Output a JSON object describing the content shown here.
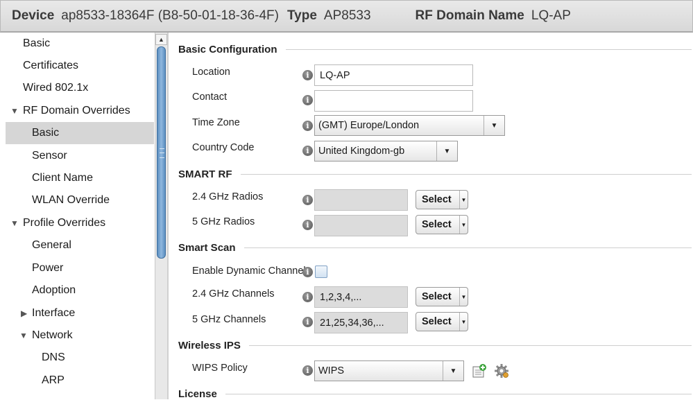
{
  "header": {
    "device_label": "Device",
    "device_value": "ap8533-18364F (B8-50-01-18-36-4F)",
    "type_label": "Type",
    "type_value": "AP8533",
    "rf_label": "RF Domain Name",
    "rf_value": "LQ-AP"
  },
  "sidebar": {
    "items": [
      {
        "label": "Basic"
      },
      {
        "label": "Certificates"
      },
      {
        "label": "Wired 802.1x"
      },
      {
        "label": "RF Domain Overrides",
        "expander": "▼"
      },
      {
        "label": "Basic"
      },
      {
        "label": "Sensor"
      },
      {
        "label": "Client Name"
      },
      {
        "label": "WLAN Override"
      },
      {
        "label": "Profile Overrides",
        "expander": "▼"
      },
      {
        "label": "General"
      },
      {
        "label": "Power"
      },
      {
        "label": "Adoption"
      },
      {
        "label": "Interface",
        "expander": "▶"
      },
      {
        "label": "Network",
        "expander": "▼"
      },
      {
        "label": "DNS"
      },
      {
        "label": "ARP"
      }
    ],
    "scroll_up_glyph": "▲"
  },
  "basic_config": {
    "title": "Basic Configuration",
    "location_label": "Location",
    "location_value": "LQ-AP",
    "contact_label": "Contact",
    "contact_value": "",
    "timezone_label": "Time Zone",
    "timezone_value": "(GMT) Europe/London",
    "country_label": "Country Code",
    "country_value": "United Kingdom-gb"
  },
  "smart_rf": {
    "title": "SMART RF",
    "radio24_label": "2.4 GHz Radios",
    "radio24_value": "",
    "radio5_label": "5 GHz Radios",
    "radio5_value": ""
  },
  "smart_scan": {
    "title": "Smart Scan",
    "dynamic_label": "Enable Dynamic Channel",
    "ch24_label": "2.4 GHz Channels",
    "ch24_value": "1,2,3,4,...",
    "ch5_label": "5 GHz Channels",
    "ch5_value": "21,25,34,36,..."
  },
  "wips": {
    "title": "Wireless IPS",
    "policy_label": "WIPS Policy",
    "policy_value": "WIPS"
  },
  "license": {
    "title": "License"
  },
  "common": {
    "select_label": "Select",
    "info_glyph": "i",
    "dropdown_glyph": "▼"
  },
  "colors": {
    "accent": "#5c8fc0",
    "header_bg": "#dedede",
    "selected_bg": "#d6d6d6"
  }
}
